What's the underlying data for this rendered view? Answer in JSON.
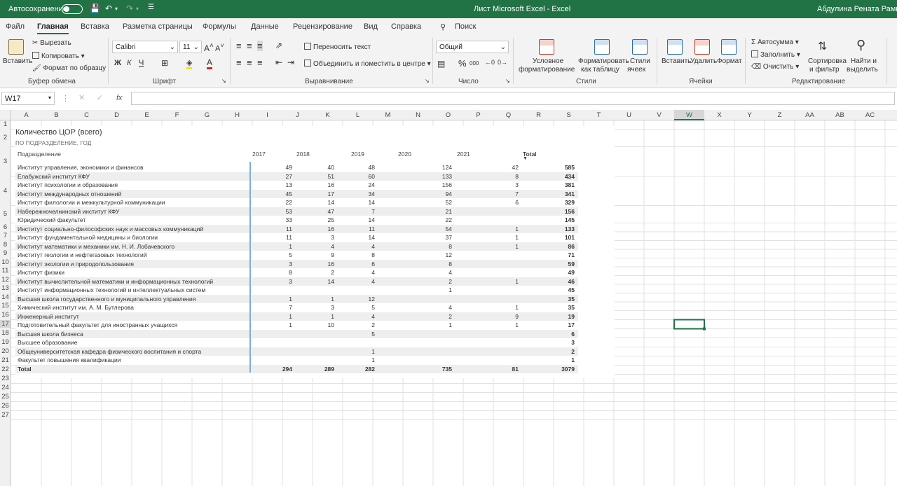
{
  "titlebar": {
    "autosave_label": "Автосохранение",
    "title": "Лист Microsoft Excel  -  Excel",
    "user": "Абдулина Рената Рамилье"
  },
  "menu": [
    "Файл",
    "Главная",
    "Вставка",
    "Разметка страницы",
    "Формулы",
    "Данные",
    "Рецензирование",
    "Вид",
    "Справка",
    "Поиск"
  ],
  "ribbon": {
    "clipboard": {
      "paste": "Вставить",
      "cut": "Вырезать",
      "copy": "Копировать",
      "format_painter": "Формат по образцу",
      "group": "Буфер обмена"
    },
    "font": {
      "name": "Calibri",
      "size": "11",
      "bold": "Ж",
      "italic": "К",
      "underline": "Ч",
      "group": "Шрифт"
    },
    "alignment": {
      "wrap": "Переносить текст",
      "merge": "Объединить и поместить в центре",
      "group": "Выравнивание"
    },
    "number": {
      "format": "Общий",
      "percent": "%",
      "thousands": "000",
      "group": "Число"
    },
    "styles": {
      "conditional": "Условное форматирование",
      "conditional_l1": "Условное",
      "conditional_l2": "форматирование",
      "table_l1": "Форматировать",
      "table_l2": "как таблицу",
      "cell_l1": "Стили",
      "cell_l2": "ячеек",
      "group": "Стили"
    },
    "cells": {
      "insert": "Вставить",
      "delete": "Удалить",
      "format": "Формат",
      "group": "Ячейки"
    },
    "editing": {
      "autosum": "Автосумма",
      "fill": "Заполнить",
      "clear": "Очистить",
      "sort_l1": "Сортировка",
      "sort_l2": "и фильтр",
      "find_l1": "Найти и",
      "find_l2": "выделить",
      "group": "Редактирование"
    }
  },
  "formula_bar": {
    "name_box": "W17",
    "fx": "fx",
    "value": ""
  },
  "columns": [
    "A",
    "B",
    "C",
    "D",
    "E",
    "F",
    "G",
    "H",
    "I",
    "J",
    "K",
    "L",
    "M",
    "N",
    "O",
    "P",
    "Q",
    "R",
    "S",
    "T",
    "U",
    "V",
    "W",
    "X",
    "Y",
    "Z",
    "AA",
    "AB",
    "AC"
  ],
  "rows": [
    "1",
    "2",
    "3",
    "4",
    "5",
    "6",
    "7",
    "8",
    "9",
    "10",
    "11",
    "12",
    "13",
    "14",
    "15",
    "16",
    "17",
    "18",
    "19",
    "20",
    "21",
    "22",
    "23",
    "24",
    "25",
    "26",
    "27"
  ],
  "selected_cell": "W17",
  "visual": {
    "title": "Количество ЦОР (всего)",
    "subtitle": "ПО ПОДРАЗДЕЛЕНИЕ, ГОД",
    "headers": {
      "unit": "Подразделение",
      "y2017": "2017",
      "y2018": "2018",
      "y2019": "2019",
      "y2020": "2020",
      "y2021": "2021",
      "total": "Total"
    },
    "rows": [
      {
        "name": "Институт управления, экономики и финансов",
        "v": [
          "49",
          "40",
          "48",
          "124",
          "42"
        ],
        "total": "585"
      },
      {
        "name": "Елабужский институт КФУ",
        "v": [
          "27",
          "51",
          "60",
          "133",
          "8"
        ],
        "total": "434"
      },
      {
        "name": "Институт психологии и образования",
        "v": [
          "13",
          "16",
          "24",
          "156",
          "3"
        ],
        "total": "381"
      },
      {
        "name": "Институт международных отношений",
        "v": [
          "45",
          "17",
          "34",
          "94",
          "7"
        ],
        "total": "341"
      },
      {
        "name": "Институт филологии и межкультурной коммуникации",
        "v": [
          "22",
          "14",
          "14",
          "52",
          "6"
        ],
        "total": "329"
      },
      {
        "name": "Набережночелнинский институт КФУ",
        "v": [
          "53",
          "47",
          "7",
          "21",
          ""
        ],
        "total": "156"
      },
      {
        "name": "Юридический факультет",
        "v": [
          "33",
          "25",
          "14",
          "22",
          ""
        ],
        "total": "145"
      },
      {
        "name": "Институт социально-философских наук и массовых коммуникаций",
        "v": [
          "11",
          "16",
          "11",
          "54",
          "1"
        ],
        "total": "133"
      },
      {
        "name": "Институт фундаментальной медицины и биологии",
        "v": [
          "11",
          "3",
          "14",
          "37",
          "1"
        ],
        "total": "101"
      },
      {
        "name": "Институт математики и механики им. Н. И. Лобачевского",
        "v": [
          "1",
          "4",
          "4",
          "8",
          "1"
        ],
        "total": "86"
      },
      {
        "name": "Институт геологии и нефтегазовых технологий",
        "v": [
          "5",
          "9",
          "8",
          "12",
          ""
        ],
        "total": "71"
      },
      {
        "name": "Институт экологии и природопользования",
        "v": [
          "3",
          "16",
          "6",
          "8",
          ""
        ],
        "total": "59"
      },
      {
        "name": "Институт физики",
        "v": [
          "8",
          "2",
          "4",
          "4",
          ""
        ],
        "total": "49"
      },
      {
        "name": "Институт вычислительной математики и информационных технологий",
        "v": [
          "3",
          "14",
          "4",
          "2",
          "1"
        ],
        "total": "46"
      },
      {
        "name": "Институт информационных технологий и интеллектуальных систем",
        "v": [
          "",
          "",
          "",
          "1",
          ""
        ],
        "total": "45"
      },
      {
        "name": "Высшая школа государственного и муниципального управления",
        "v": [
          "1",
          "1",
          "12",
          "",
          ""
        ],
        "total": "35"
      },
      {
        "name": "Химический институт им. А. М. Бутлерова",
        "v": [
          "7",
          "3",
          "5",
          "4",
          "1"
        ],
        "total": "35"
      },
      {
        "name": "Инженерный институт",
        "v": [
          "1",
          "1",
          "4",
          "2",
          "9"
        ],
        "total": "19"
      },
      {
        "name": "Подготовительный факультет для иностранных учащихся",
        "v": [
          "1",
          "10",
          "2",
          "1",
          "1"
        ],
        "total": "17"
      },
      {
        "name": "Высшая школа бизнеса",
        "v": [
          "",
          "",
          "5",
          "",
          ""
        ],
        "total": "6"
      },
      {
        "name": "Высшее образование",
        "v": [
          "",
          "",
          "",
          "",
          ""
        ],
        "total": "3"
      },
      {
        "name": "Общеуниверситетская кафедра физического воспитания и спорта",
        "v": [
          "",
          "",
          "1",
          "",
          ""
        ],
        "total": "2"
      },
      {
        "name": "Факультет повышения квалификации",
        "v": [
          "",
          "",
          "1",
          "",
          ""
        ],
        "total": "1"
      },
      {
        "name": "Total",
        "v": [
          "294",
          "289",
          "282",
          "735",
          "81"
        ],
        "total": "3079"
      }
    ]
  }
}
